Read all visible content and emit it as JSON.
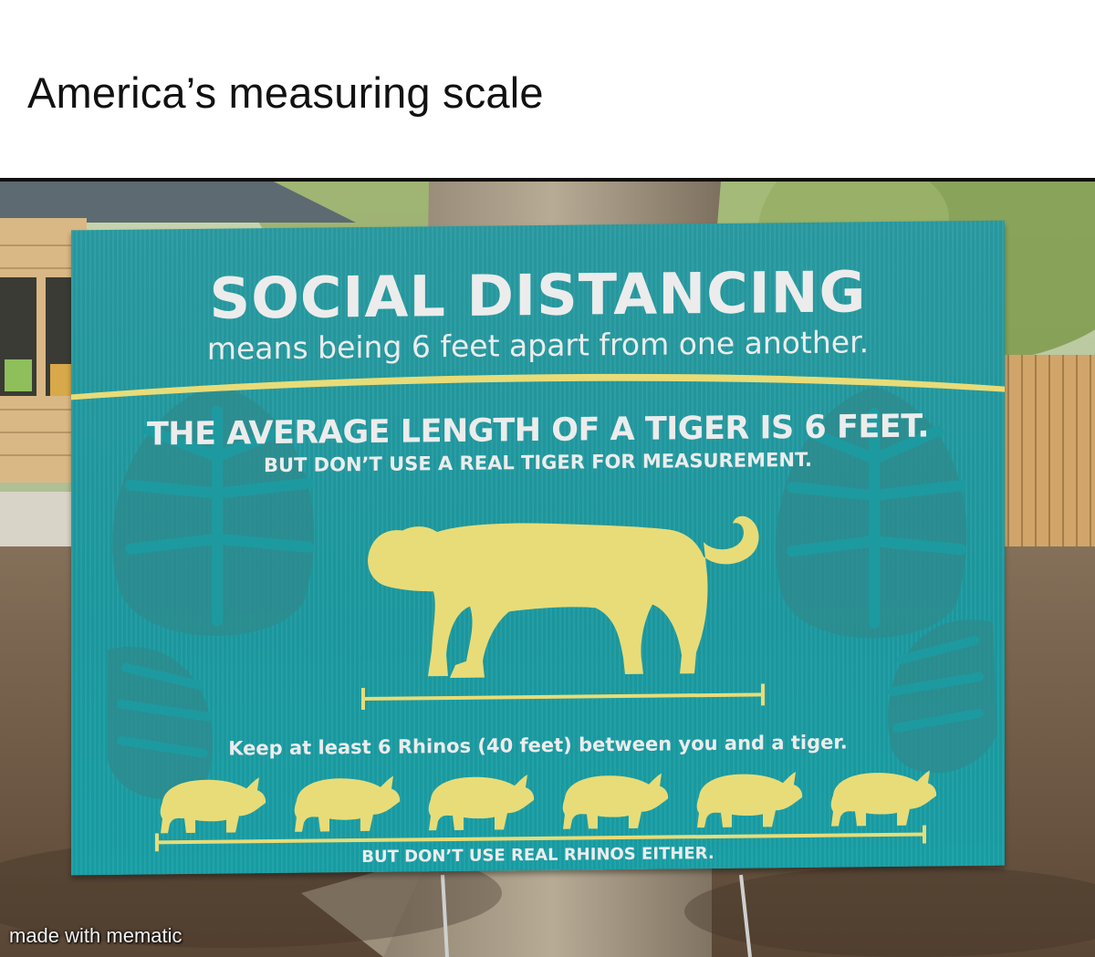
{
  "meme": {
    "caption": "America’s measuring scale",
    "watermark": "made with mematic"
  },
  "sign": {
    "title": "SOCIAL DISTANCING",
    "subtitle": "means being 6 feet apart from one another.",
    "fact": "THE AVERAGE LENGTH OF A TIGER IS 6 FEET.",
    "fact_note": "BUT DON’T USE A REAL TIGER FOR MEASUREMENT.",
    "rhino_rule": "Keep at least 6 Rhinos (40 feet) between you and a tiger.",
    "rhino_note": "BUT DON’T USE REAL RHINOS EITHER.",
    "rhino_count": 6
  },
  "colors": {
    "sign_teal": "#1d9aa0",
    "silhouette_yellow": "#e8dc78",
    "leaf_teal": "#2f8a8c",
    "sign_text": "#ececec"
  },
  "icons": [
    "tiger-silhouette",
    "rhino-silhouette",
    "monstera-leaf-icon"
  ]
}
